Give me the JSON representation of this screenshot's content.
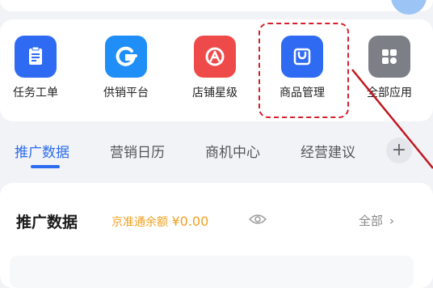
{
  "apps": [
    {
      "label": "任务工单",
      "icon": "task-order-icon",
      "color": "#2f6bf2"
    },
    {
      "label": "供销平台",
      "icon": "supply-platform-icon",
      "color": "#1f8ef7"
    },
    {
      "label": "店铺星级",
      "icon": "store-rating-icon",
      "color": "#ef4a4a"
    },
    {
      "label": "商品管理",
      "icon": "product-management-icon",
      "color": "#2f6bf2"
    },
    {
      "label": "全部应用",
      "icon": "all-apps-icon",
      "color": "#7c7f86"
    }
  ],
  "highlight_color": "#d81e2e",
  "tabs": {
    "items": [
      "推广数据",
      "营销日历",
      "商机中心",
      "经营建议"
    ],
    "active_index": 0,
    "more_symbol": "+"
  },
  "promo": {
    "title": "推广数据",
    "balance_label": "京准通余额",
    "balance_currency": "¥",
    "balance_value": "0.00",
    "see_all": "全部",
    "see_all_chevron": "›"
  }
}
